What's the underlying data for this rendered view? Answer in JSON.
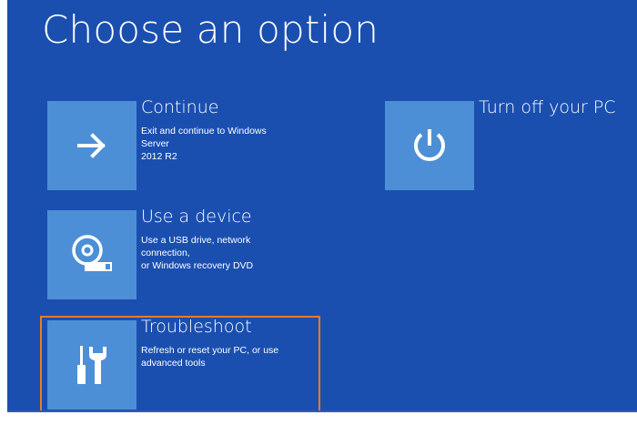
{
  "screen": {
    "title": "Choose an option",
    "colors": {
      "background": "#1a4fb0",
      "tile": "#4d8fd6",
      "text": "#ffffff",
      "highlight": "#f07b24"
    }
  },
  "options": [
    {
      "label": "Continue",
      "description": "Exit and continue to Windows Server\n2012 R2",
      "icon": "arrow-right-icon"
    },
    {
      "label": "Use a device",
      "description": "Use a USB drive, network connection,\nor Windows recovery DVD",
      "icon": "disc-drive-icon"
    },
    {
      "label": "Troubleshoot",
      "description": "Refresh or reset your PC, or use\nadvanced tools",
      "icon": "tools-icon",
      "highlighted": true
    },
    {
      "label": "Turn off your PC",
      "description": "",
      "icon": "power-icon"
    }
  ]
}
